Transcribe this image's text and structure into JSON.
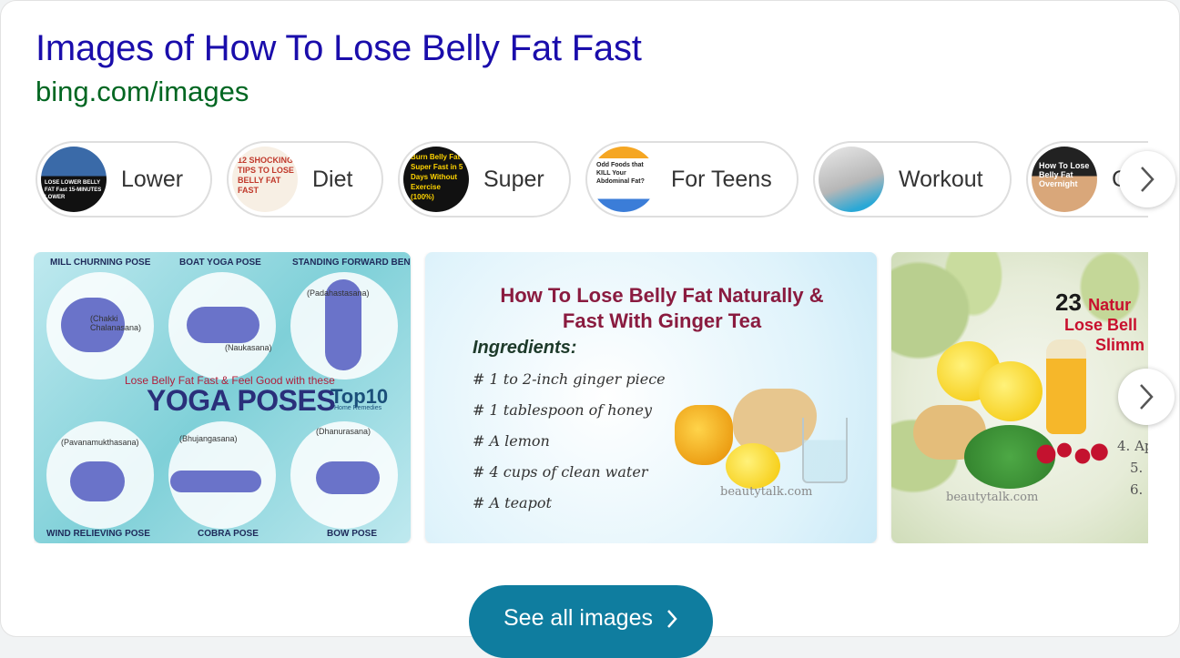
{
  "result": {
    "title": "Images of How To Lose Belly Fat Fast",
    "source": "bing.com/images"
  },
  "chips": [
    {
      "label": "Lower",
      "thumb_text": "LOSE LOWER BELLY FAT Fast 15-MINUTES LOWER",
      "thumb_color": "#2a2a2a"
    },
    {
      "label": "Diet",
      "thumb_text": "12 SHOCKING TIPS TO LOSE BELLY FAT FAST",
      "thumb_color": "#c0392b"
    },
    {
      "label": "Super",
      "thumb_text": "Burn Belly Fat Super Fast in 5 Days Without Exercise (100%)",
      "thumb_color": "#111111"
    },
    {
      "label": "For Teens",
      "thumb_text": "Odd Foods that KILL Your Abdominal Fat?",
      "thumb_color": "#f5a623"
    },
    {
      "label": "Workout",
      "thumb_text": "",
      "thumb_color": "#b7b7b7"
    },
    {
      "label": "C",
      "thumb_text": "How To Lose Belly Fat Overnight",
      "thumb_color": "#222222"
    }
  ],
  "images": {
    "yoga": {
      "poses_top": [
        "MILL CHURNING POSE",
        "BOAT YOGA POSE",
        "STANDING FORWARD BEND"
      ],
      "poses_bottom": [
        "WIND RELIEVING POSE",
        "COBRA POSE",
        "BOW POSE"
      ],
      "sanskrit": [
        "(Chakki Chalanasana)",
        "(Naukasana)",
        "(Padahastasana)",
        "(Pavanamukthasana)",
        "(Bhujangasana)",
        "(Dhanurasana)"
      ],
      "subtitle": "Lose Belly Fat Fast & Feel Good with these",
      "headline": "YOGA POSES",
      "brand": "Top10",
      "brand_sub": "Home Remedies"
    },
    "ginger": {
      "title_line1": "How To Lose Belly Fat Naturally &",
      "title_line2": "Fast With Ginger Tea",
      "ingredients_heading": "Ingredients:",
      "ingredients": [
        "# 1 to 2-inch ginger piece",
        "# 1 tablespoon of honey",
        "# A lemon",
        "# 4 cups of clean water",
        "# A teapot"
      ],
      "watermark": "beautytalk.com"
    },
    "natural": {
      "number": "23",
      "line1": "Natur",
      "line2": "Lose Bell",
      "line3": "Slimm",
      "watermark": "beautytalk.com",
      "side": [
        "4. Ap",
        "5.",
        "6. ("
      ]
    }
  },
  "see_all": {
    "label": "See all images"
  },
  "colors": {
    "title": "#1a0dab",
    "url": "#006621",
    "button": "#0f7d9f"
  }
}
